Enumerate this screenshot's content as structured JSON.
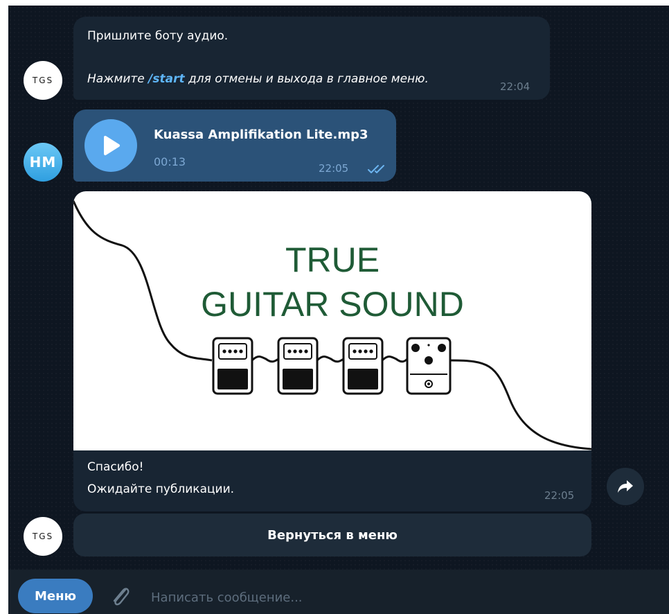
{
  "messages": {
    "bot_prompt": {
      "avatar_text": "TGS",
      "line1": "Пришлите боту аудио.",
      "line2_prefix": "Нажмите ",
      "line2_command": "/start",
      "line2_suffix": " для отмены и выхода в главное меню.",
      "time": "22:04"
    },
    "user_audio": {
      "avatar_text": "HM",
      "file_name": "Kuassa Amplifikation Lite.mp3",
      "duration": "00:13",
      "time": "22:05",
      "status_icon": "double-check-icon"
    },
    "bot_reply": {
      "avatar_text": "TGS",
      "image_logo": {
        "line1": "TRUE",
        "line2": "GUITAR SOUND"
      },
      "line1": "Спасибо!",
      "line2": "Ожидайте публикации.",
      "time": "22:05",
      "inline_button": "Вернуться в меню"
    }
  },
  "composer": {
    "menu_label": "Меню",
    "placeholder": "Написать сообщение...",
    "attach_icon": "paperclip-icon"
  },
  "colors": {
    "chat_background": "#0e1621",
    "incoming_bubble": "#182533",
    "outgoing_bubble": "#2b5278",
    "accent": "#5eb5f7",
    "logo_green": "#1f5b36"
  }
}
